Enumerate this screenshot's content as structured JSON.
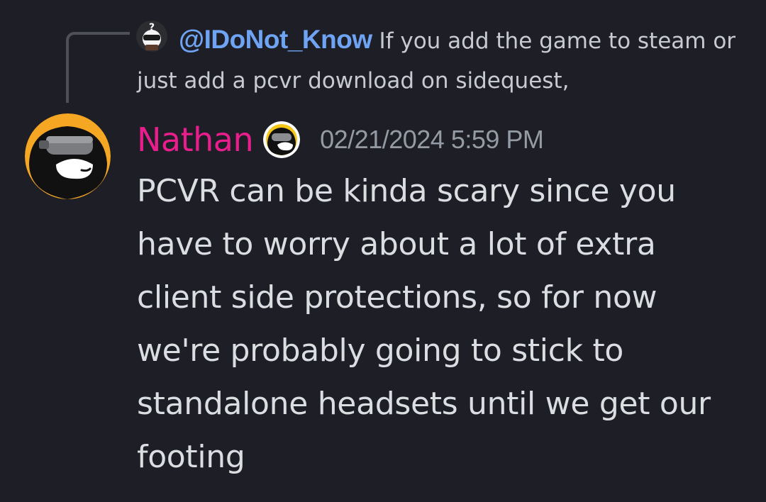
{
  "reply": {
    "mention": "@IDoNot_Know",
    "text": " If you add the game to steam or just add a pcvr download on sidequest,"
  },
  "message": {
    "author": "Nathan",
    "timestamp": "02/21/2024 5:59 PM",
    "content": "PCVR can be kinda scary since you have to worry about a lot of extra client side protections, so for now we're probably going to stick to standalone headsets until we get our footing"
  },
  "icons": {
    "reply_avatar": "question-mark-avatar-icon",
    "author_avatar": "vr-headset-gorilla-avatar-icon",
    "role_badge": "vr-headset-gorilla-badge-icon"
  },
  "colors": {
    "background": "#1e1f26",
    "author_name": "#e91e8c",
    "mention": "#6fa4f5",
    "avatar_ring": "#f5a623"
  }
}
